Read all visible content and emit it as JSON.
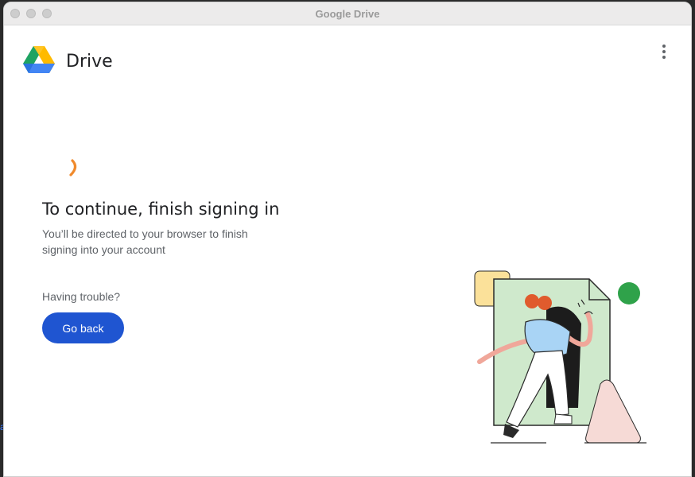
{
  "window": {
    "title": "Google Drive"
  },
  "header": {
    "app_name": "Drive",
    "menu_icon": "more-vert-icon"
  },
  "main": {
    "heading": "To continue, finish signing in",
    "subtext": "You’ll be directed to your browser to finish signing into your account",
    "trouble_text": "Having trouble?",
    "go_back_label": "Go back"
  },
  "colors": {
    "accent": "#1f55d1",
    "spinner": "#f08a2c",
    "drive_green": "#1ea362",
    "drive_yellow": "#ffba00",
    "drive_blue": "#4285f4"
  }
}
